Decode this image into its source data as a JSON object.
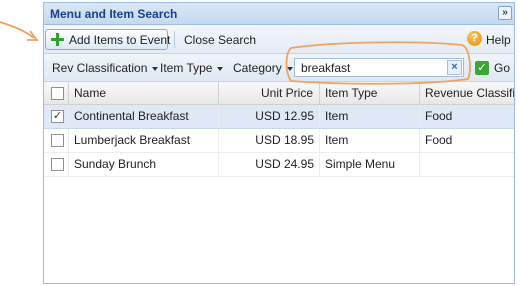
{
  "panel": {
    "title": "Menu and Item Search",
    "collapse_glyph": "»"
  },
  "toolbar": {
    "add_items_label": "Add Items to Event",
    "close_search_label": "Close Search",
    "help_label": "Help",
    "help_glyph": "?"
  },
  "filters": {
    "rev_classification": "Rev Classification",
    "item_type": "Item Type",
    "category": "Category",
    "search_value": "breakfast",
    "clear_glyph": "×",
    "go_glyph": "✓",
    "go_label": "Go"
  },
  "grid": {
    "columns": [
      "Name",
      "Unit Price",
      "Item Type",
      "Revenue Classificat"
    ],
    "rows": [
      {
        "name": "Continental Breakfast",
        "unit_price": "USD 12.95",
        "item_type": "Item",
        "revenue_class": "Food",
        "checked": "✓",
        "selected": true
      },
      {
        "name": "Lumberjack Breakfast",
        "unit_price": "USD 18.95",
        "item_type": "Item",
        "revenue_class": "Food",
        "checked": "",
        "selected": false
      },
      {
        "name": "Sunday Brunch",
        "unit_price": "USD 24.95",
        "item_type": "Simple Menu",
        "revenue_class": "",
        "checked": "",
        "selected": false
      }
    ]
  },
  "colors": {
    "annotation": "#f0a35e",
    "header_text": "#15428b",
    "selected_row": "#dfe8f6"
  }
}
